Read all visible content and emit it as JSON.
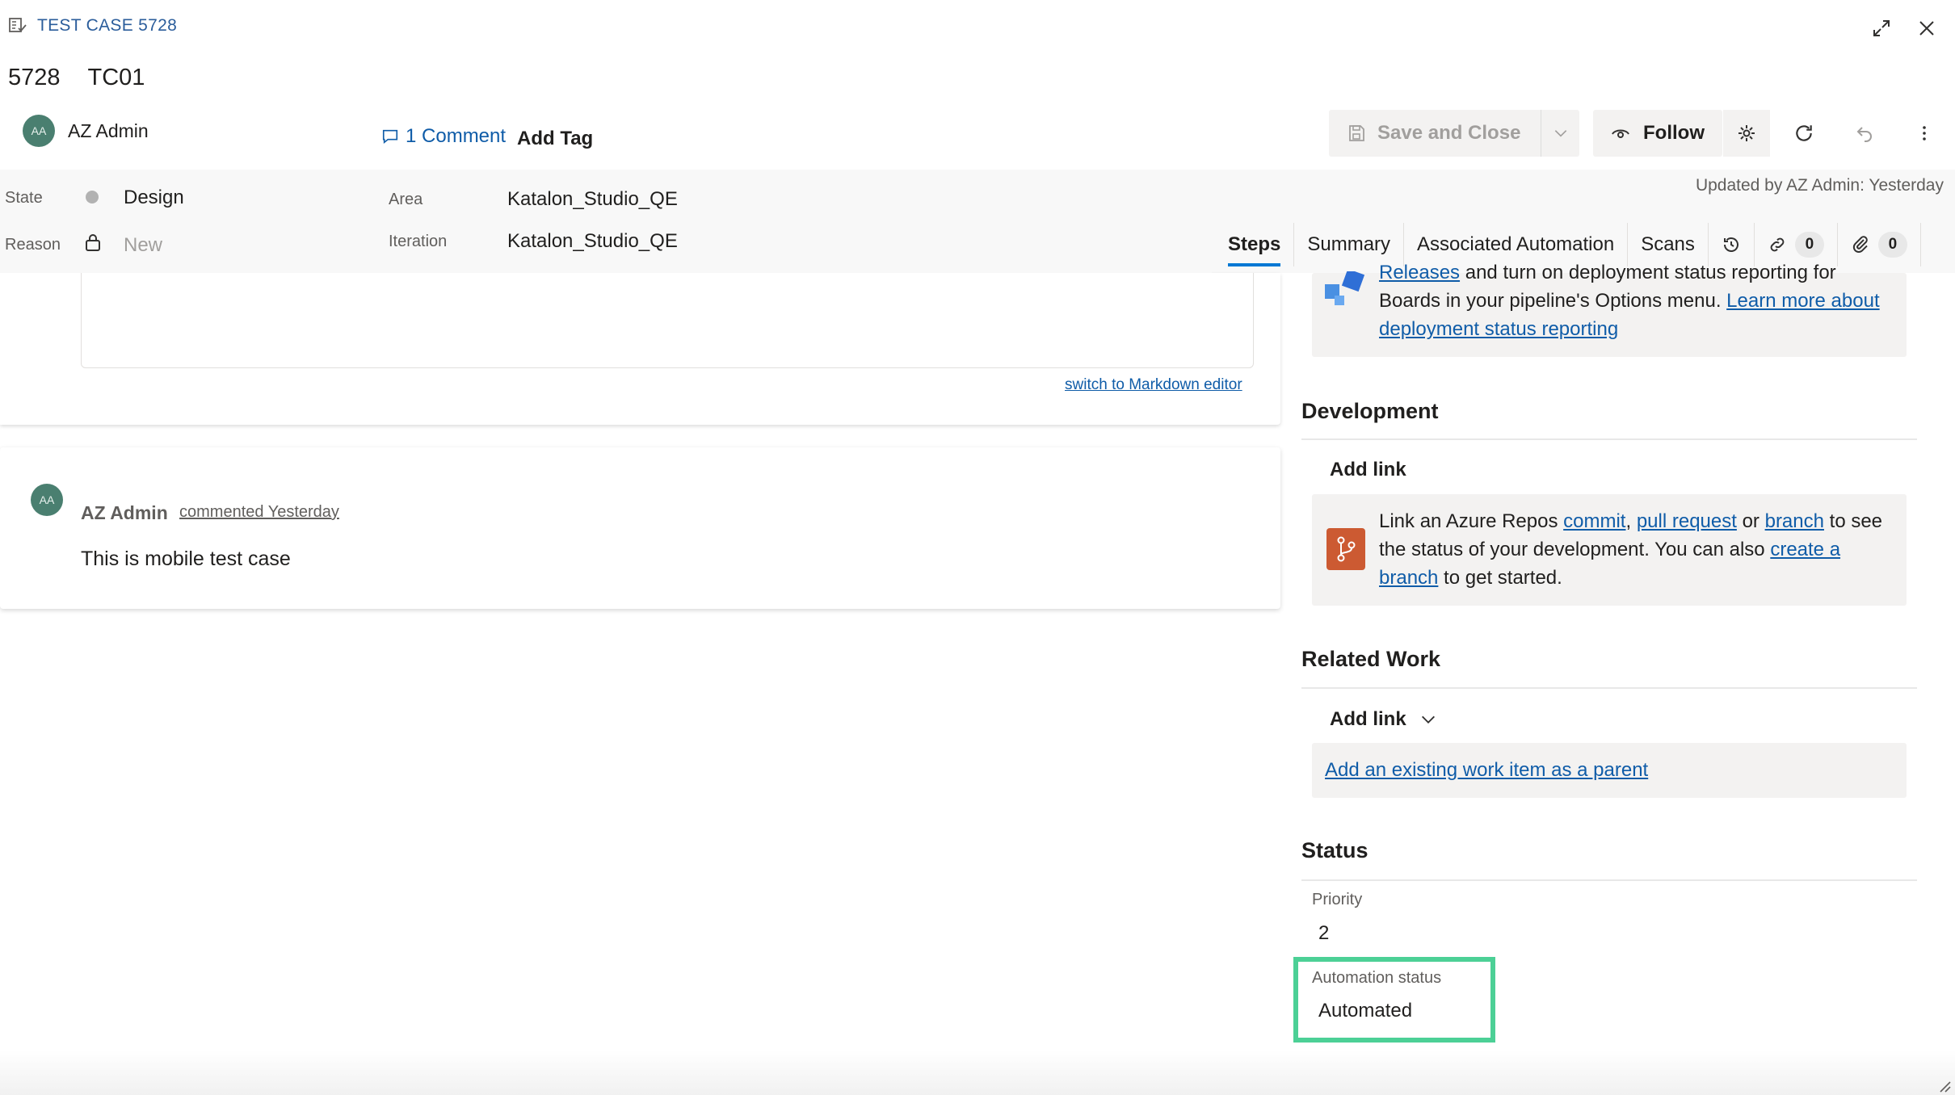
{
  "window": {
    "type_label": "TEST CASE 5728",
    "id": "5728",
    "title": "TC01"
  },
  "header": {
    "assigned_to": "AZ Admin",
    "avatar_initials": "AA",
    "comment_link": "1 Comment",
    "add_tag": "Add Tag",
    "updated": "Updated by AZ Admin: Yesterday"
  },
  "toolbar": {
    "save_label": "Save and Close",
    "follow_label": "Follow"
  },
  "fields": {
    "state_label": "State",
    "state_value": "Design",
    "reason_label": "Reason",
    "reason_value": "New",
    "area_label": "Area",
    "area_value": "Katalon_Studio_QE",
    "iteration_label": "Iteration",
    "iteration_value": "Katalon_Studio_QE"
  },
  "tabs": [
    {
      "label": "Steps",
      "active": true
    },
    {
      "label": "Summary"
    },
    {
      "label": "Associated Automation"
    },
    {
      "label": "Scans"
    }
  ],
  "counts": {
    "links": "0",
    "attachments": "0"
  },
  "editor": {
    "markdown_link": "switch to Markdown editor"
  },
  "comment": {
    "author": "AZ Admin",
    "initials": "AA",
    "when": "commented Yesterday",
    "text": "This is mobile test case"
  },
  "deployment": {
    "releases_link": "Releases",
    "text_1": " and turn on deployment status reporting for",
    "text_2": "Boards in your pipeline's Options menu. ",
    "learn_more_1": "Learn more about",
    "learn_more_2": "deployment status reporting"
  },
  "development": {
    "title": "Development",
    "add_link": "Add link",
    "t1": "Link an Azure Repos ",
    "commit": "commit",
    "comma": ", ",
    "pull_request": "pull request",
    "or": " or ",
    "branch": "branch",
    "t2": " to see",
    "t3": "the status of your development. You can also ",
    "create_a": "create a",
    "branch2": "branch",
    "t4": " to get started."
  },
  "related_work": {
    "title": "Related Work",
    "add_link": "Add link",
    "parent_link": "Add an existing work item as a parent"
  },
  "status": {
    "title": "Status",
    "priority_label": "Priority",
    "priority_value": "2",
    "automation_label": "Automation status",
    "automation_value": "Automated",
    "highlight_color": "#4cd096"
  }
}
